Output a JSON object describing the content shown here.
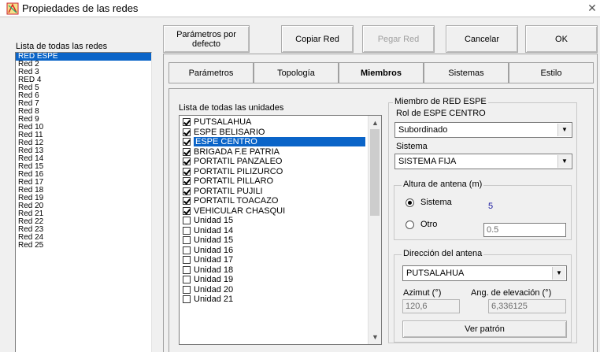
{
  "window": {
    "title": "Propiedades de las redes",
    "close_glyph": "✕"
  },
  "networks": {
    "label": "Lista de todas las redes",
    "items": [
      "RED ESPE",
      "Red  2",
      "Red  3",
      "RED 4",
      "Red  5",
      "Red  6",
      "Red  7",
      "Red  8",
      "Red  9",
      "Red 10",
      "Red 11",
      "Red 12",
      "Red 13",
      "Red 14",
      "Red 15",
      "Red 16",
      "Red 17",
      "Red 18",
      "Red 19",
      "Red 20",
      "Red 21",
      "Red 22",
      "Red 23",
      "Red 24",
      "Red 25"
    ],
    "selected_index": 0
  },
  "toolbar": {
    "defaults_line1": "Parámetros por",
    "defaults_line2": "defecto",
    "copy": "Copiar Red",
    "paste": "Pegar Red",
    "cancel": "Cancelar",
    "ok": "OK"
  },
  "tabs": [
    "Parámetros",
    "Topología",
    "Miembros",
    "Sistemas",
    "Estilo"
  ],
  "active_tab": "Miembros",
  "units": {
    "label": "Lista de todas las unidades",
    "items": [
      {
        "name": "PUTSALAHUA",
        "checked": true
      },
      {
        "name": "ESPE BELISARIO",
        "checked": true
      },
      {
        "name": "ESPE CENTRO",
        "checked": true,
        "selected": true
      },
      {
        "name": "BRIGADA F.E PATRIA",
        "checked": true
      },
      {
        "name": "PORTATIL PANZALEO",
        "checked": true
      },
      {
        "name": "PORTATIL PILIZURCO",
        "checked": true
      },
      {
        "name": "PORTATIL PILLARO",
        "checked": true
      },
      {
        "name": "PORTATIL PUJILI",
        "checked": true
      },
      {
        "name": "PORTATIL  TOACAZO",
        "checked": true
      },
      {
        "name": "VEHICULAR CHASQUI",
        "checked": true
      },
      {
        "name": "Unidad  15",
        "checked": false
      },
      {
        "name": "Unidad  14",
        "checked": false
      },
      {
        "name": "Unidad  15",
        "checked": false
      },
      {
        "name": "Unidad  16",
        "checked": false
      },
      {
        "name": "Unidad  17",
        "checked": false
      },
      {
        "name": "Unidad  18",
        "checked": false
      },
      {
        "name": "Unidad  19",
        "checked": false
      },
      {
        "name": "Unidad  20",
        "checked": false
      },
      {
        "name": "Unidad  21",
        "checked": false
      }
    ]
  },
  "member": {
    "group_title": "Miembro de RED ESPE",
    "role_label": "Rol de ESPE CENTRO",
    "role_value": "Subordinado",
    "system_label": "Sistema",
    "system_value": "SISTEMA FIJA",
    "antenna_height": {
      "title": "Altura de antena (m)",
      "option_system": "Sistema",
      "system_value": "5",
      "option_other": "Otro",
      "other_value": "0.5"
    },
    "direction": {
      "title": "Dirección del antena",
      "target": "PUTSALAHUA",
      "azimuth_label": "Azimut (°)",
      "elevation_label": "Ang. de elevación (°)",
      "azimuth_value": "120,6",
      "elevation_value": "6,336125",
      "pattern_button": "Ver patrón"
    }
  },
  "colors": {
    "selection": "#0a64c8",
    "value_blue": "#1a1aa0"
  }
}
